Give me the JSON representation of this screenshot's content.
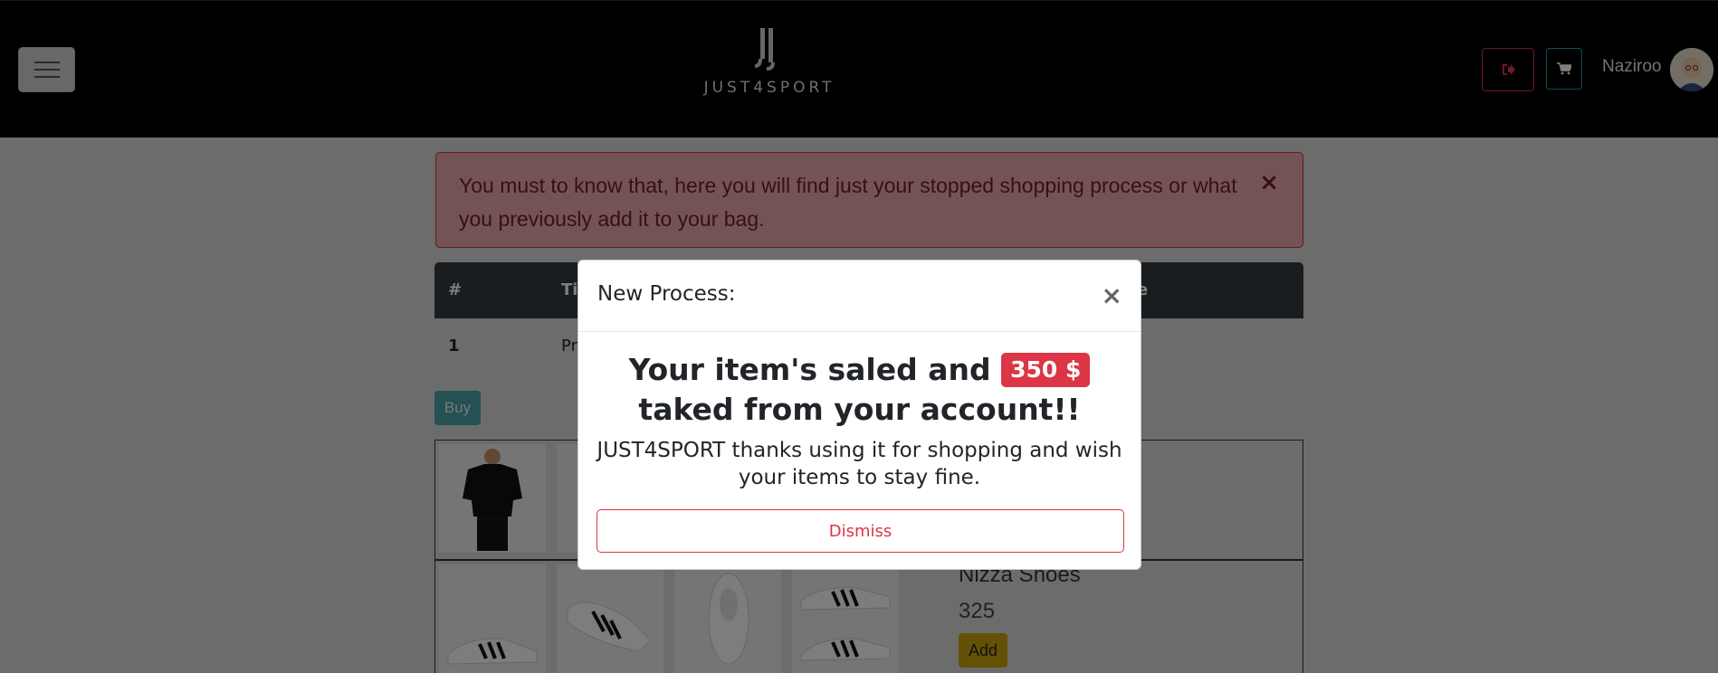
{
  "navbar": {
    "brand": "JUST4SPORT",
    "username": "Naziroo"
  },
  "alert": {
    "message": "You must to know that, here you will find just your stopped shopping process or what you previously add it to your bag.",
    "close": "×"
  },
  "table": {
    "headers": [
      "#",
      "Ti",
      "e"
    ],
    "rows": [
      {
        "num": "1",
        "title": "Pr"
      }
    ]
  },
  "buy_label": "Buy",
  "products": [
    {
      "name": "Nizza Shoes",
      "price": "325",
      "add_label": "Add"
    }
  ],
  "modal": {
    "title": "New Process:",
    "close": "×",
    "headline_before": "Your item's saled and",
    "amount": "350 $",
    "headline_after": "taked from your account!!",
    "subtext": "JUST4SPORT thanks using it for shopping and wish your items to stay fine.",
    "dismiss_label": "Dismiss"
  },
  "colors": {
    "danger": "#dc3545",
    "info": "#17a2b8",
    "warning": "#ffc107",
    "navbar": "#000000"
  }
}
